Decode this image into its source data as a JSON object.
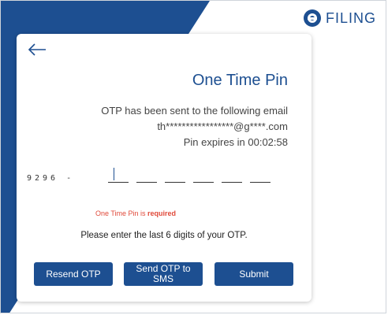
{
  "brand": {
    "logo_text": "FILING",
    "logo_icon": "e-filing-logo-icon",
    "primary_color": "#1d4f91",
    "error_color": "#e04a3a"
  },
  "header": {
    "back_icon": "arrow-left-icon"
  },
  "otp": {
    "title": "One Time Pin",
    "sent_message": "OTP has been sent to the following email",
    "masked_email": "th*****************@g****.com",
    "expiry_text": "Pin expires in 00:02:58",
    "prefix": "9296 -",
    "digits": [
      "",
      "",
      "",
      "",
      "",
      ""
    ],
    "error_prefix": "One Time Pin is",
    "error_bold": "required",
    "hint": "Please enter the last 6 digits of your OTP."
  },
  "buttons": {
    "resend": "Resend OTP",
    "sms": "Send OTP to\nSMS",
    "submit": "Submit"
  }
}
